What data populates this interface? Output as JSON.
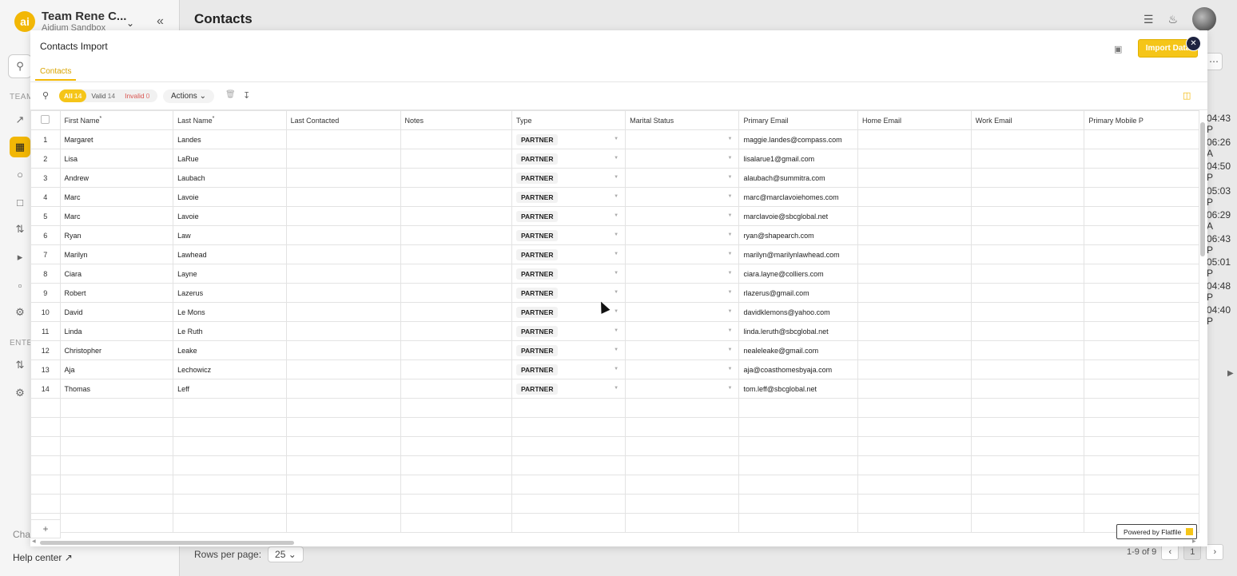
{
  "app": {
    "team_name": "Team Rene C...",
    "team_sub": "Aidium Sandbox",
    "logo_text": "ai",
    "section_team": "TEAM",
    "section_enter": "ENTER",
    "chat_label": "Chat",
    "help_center": "Help center",
    "page_title": "Contacts",
    "bg_times": [
      "04:43 P",
      "06:26 A",
      "04:50 P",
      "05:03 P",
      "06:29 A",
      "06:43 P",
      "05:01 P",
      "04:48 P",
      "04:40 P"
    ],
    "rows_per_page_label": "Rows per page:",
    "rows_per_page_value": "25",
    "pagination_range": "1-9 of 9",
    "current_page": "1"
  },
  "modal": {
    "title": "Contacts Import",
    "import_button": "Import Data",
    "tab": "Contacts",
    "filters": {
      "all_label": "All",
      "all_count": "14",
      "valid_label": "Valid",
      "valid_count": "14",
      "invalid_label": "Invalid",
      "invalid_count": "0"
    },
    "actions_label": "Actions",
    "add_row": "+",
    "powered_by": "Powered by Flatfile",
    "columns": [
      "First Name",
      "Last Name",
      "Last Contacted",
      "Notes",
      "Type",
      "Marital Status",
      "Primary Email",
      "Home Email",
      "Work Email",
      "Primary Mobile P"
    ],
    "rows": [
      {
        "idx": "1",
        "first": "Margaret",
        "last": "Landes",
        "type": "PARTNER",
        "email": "maggie.landes@compass.com"
      },
      {
        "idx": "2",
        "first": "Lisa",
        "last": "LaRue",
        "type": "PARTNER",
        "email": "lisalarue1@gmail.com"
      },
      {
        "idx": "3",
        "first": "Andrew",
        "last": "Laubach",
        "type": "PARTNER",
        "email": "alaubach@summitra.com"
      },
      {
        "idx": "4",
        "first": "Marc",
        "last": "Lavoie",
        "type": "PARTNER",
        "email": "marc@marclavoiehomes.com"
      },
      {
        "idx": "5",
        "first": "Marc",
        "last": "Lavoie",
        "type": "PARTNER",
        "email": "marclavoie@sbcglobal.net"
      },
      {
        "idx": "6",
        "first": "Ryan",
        "last": "Law",
        "type": "PARTNER",
        "email": "ryan@shapearch.com"
      },
      {
        "idx": "7",
        "first": "Marilyn",
        "last": "Lawhead",
        "type": "PARTNER",
        "email": "marilyn@marilynlawhead.com"
      },
      {
        "idx": "8",
        "first": "Ciara",
        "last": "Layne",
        "type": "PARTNER",
        "email": "ciara.layne@colliers.com"
      },
      {
        "idx": "9",
        "first": "Robert",
        "last": "Lazerus",
        "type": "PARTNER",
        "email": "rlazerus@gmail.com"
      },
      {
        "idx": "10",
        "first": "David",
        "last": "Le Mons",
        "type": "PARTNER",
        "email": "davidklemons@yahoo.com"
      },
      {
        "idx": "11",
        "first": "Linda",
        "last": "Le Ruth",
        "type": "PARTNER",
        "email": "linda.leruth@sbcglobal.net"
      },
      {
        "idx": "12",
        "first": "Christopher",
        "last": "Leake",
        "type": "PARTNER",
        "email": "nealeleake@gmail.com"
      },
      {
        "idx": "13",
        "first": "Aja",
        "last": "Lechowicz",
        "type": "PARTNER",
        "email": "aja@coasthomesbyaja.com"
      },
      {
        "idx": "14",
        "first": "Thomas",
        "last": "Leff",
        "type": "PARTNER",
        "email": "tom.leff@sbcglobal.net"
      }
    ]
  }
}
